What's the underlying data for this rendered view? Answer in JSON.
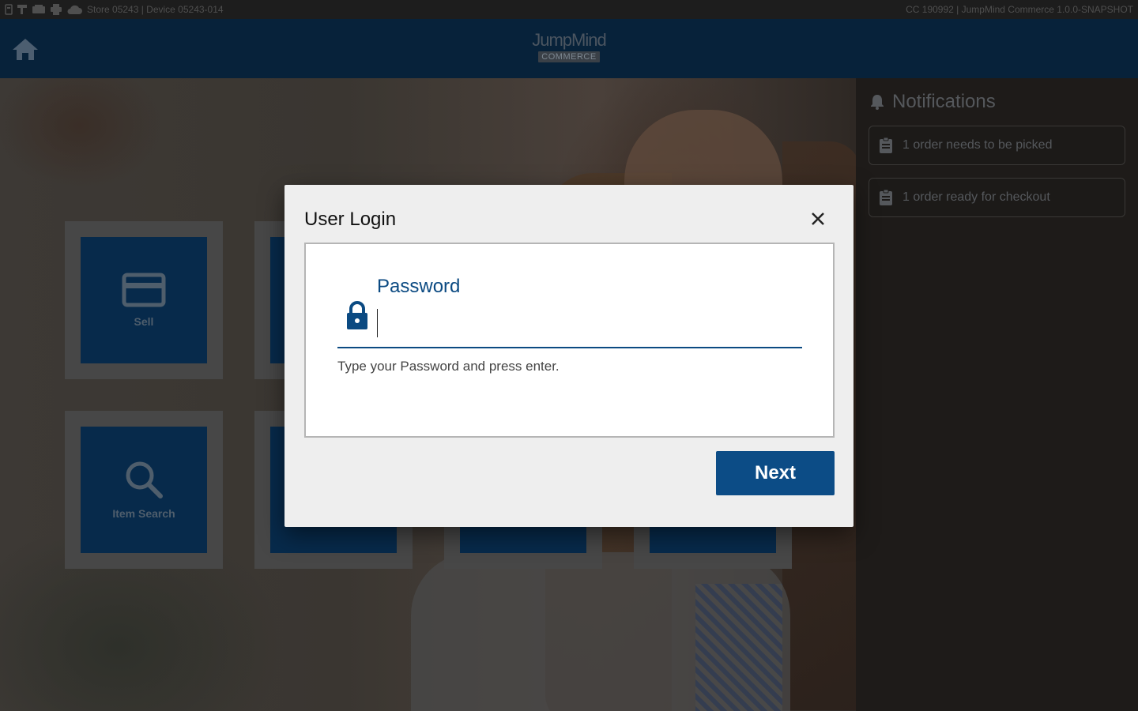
{
  "status_bar": {
    "store_device": "Store 05243 | Device 05243-014",
    "version": "CC 190992 | JumpMind Commerce 1.0.0-SNAPSHOT",
    "icons": [
      "device-icon",
      "scanner-icon",
      "cash-drawer-icon",
      "printer-icon",
      "cloud-icon"
    ]
  },
  "header": {
    "logo_word": "JumpMind",
    "logo_sub": "COMMERCE",
    "home_icon": "home-icon"
  },
  "tiles": [
    {
      "label": "Sell",
      "icon": "credit-card-icon"
    },
    {
      "label": "",
      "icon": ""
    },
    {
      "label": "Item Search",
      "icon": "search-icon"
    },
    {
      "label": "",
      "icon": ""
    },
    {
      "label": "",
      "icon": ""
    },
    {
      "label": "",
      "icon": ""
    }
  ],
  "notifications": {
    "title": "Notifications",
    "items": [
      {
        "text": "1 order needs to be picked",
        "icon": "clipboard-icon"
      },
      {
        "text": "1 order ready for checkout",
        "icon": "clipboard-icon"
      }
    ]
  },
  "dialog": {
    "title": "User Login",
    "field_label": "Password",
    "field_value": "",
    "hint": "Type your Password and press enter.",
    "next_label": "Next"
  },
  "colors": {
    "header_bg": "#07223a",
    "accent": "#0c4c86",
    "tile_bg": "#072a4b",
    "dialog_bg": "#eeeeee"
  }
}
